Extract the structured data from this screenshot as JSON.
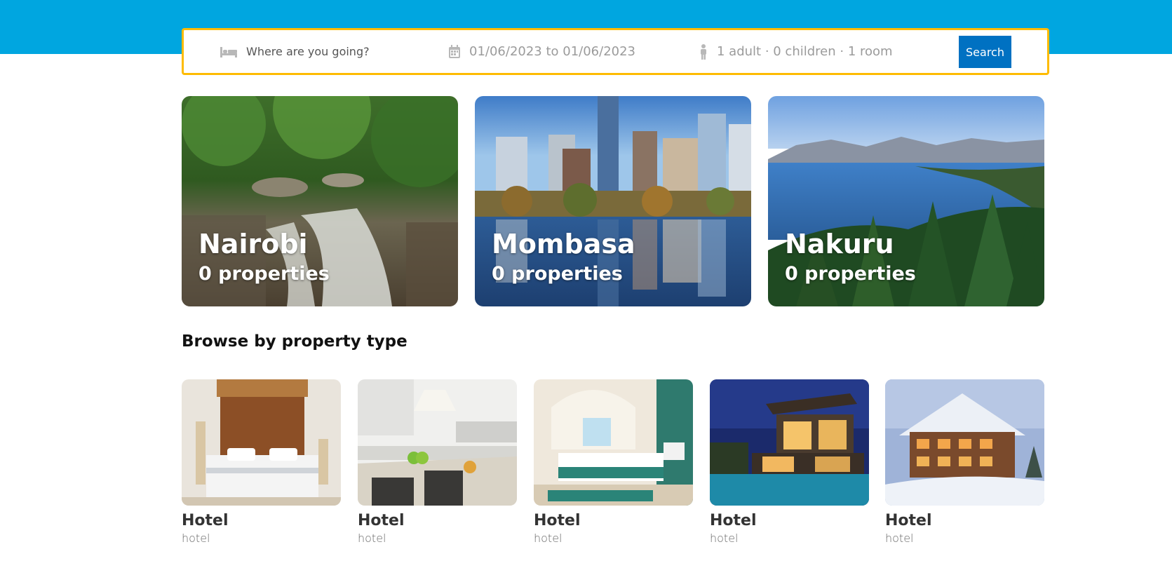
{
  "colors": {
    "header": "#00a6e0",
    "search_border": "#febb02",
    "search_button": "#0071c2"
  },
  "search": {
    "destination_placeholder": "Where are you going?",
    "dates": "01/06/2023 to 01/06/2023",
    "guests": "1 adult · 0 children · 1 room",
    "button_label": "Search",
    "icons": [
      "bed-icon",
      "calendar-icon",
      "person-icon"
    ]
  },
  "cities": [
    {
      "name": "Nairobi",
      "count": "0 properties"
    },
    {
      "name": "Mombasa",
      "count": "0 properties"
    },
    {
      "name": "Nakuru",
      "count": "0 properties"
    }
  ],
  "section_title": "Browse by property type",
  "property_types": [
    {
      "title": "Hotel",
      "subtitle": "hotel"
    },
    {
      "title": "Hotel",
      "subtitle": "hotel"
    },
    {
      "title": "Hotel",
      "subtitle": "hotel"
    },
    {
      "title": "Hotel",
      "subtitle": "hotel"
    },
    {
      "title": "Hotel",
      "subtitle": "hotel"
    }
  ]
}
